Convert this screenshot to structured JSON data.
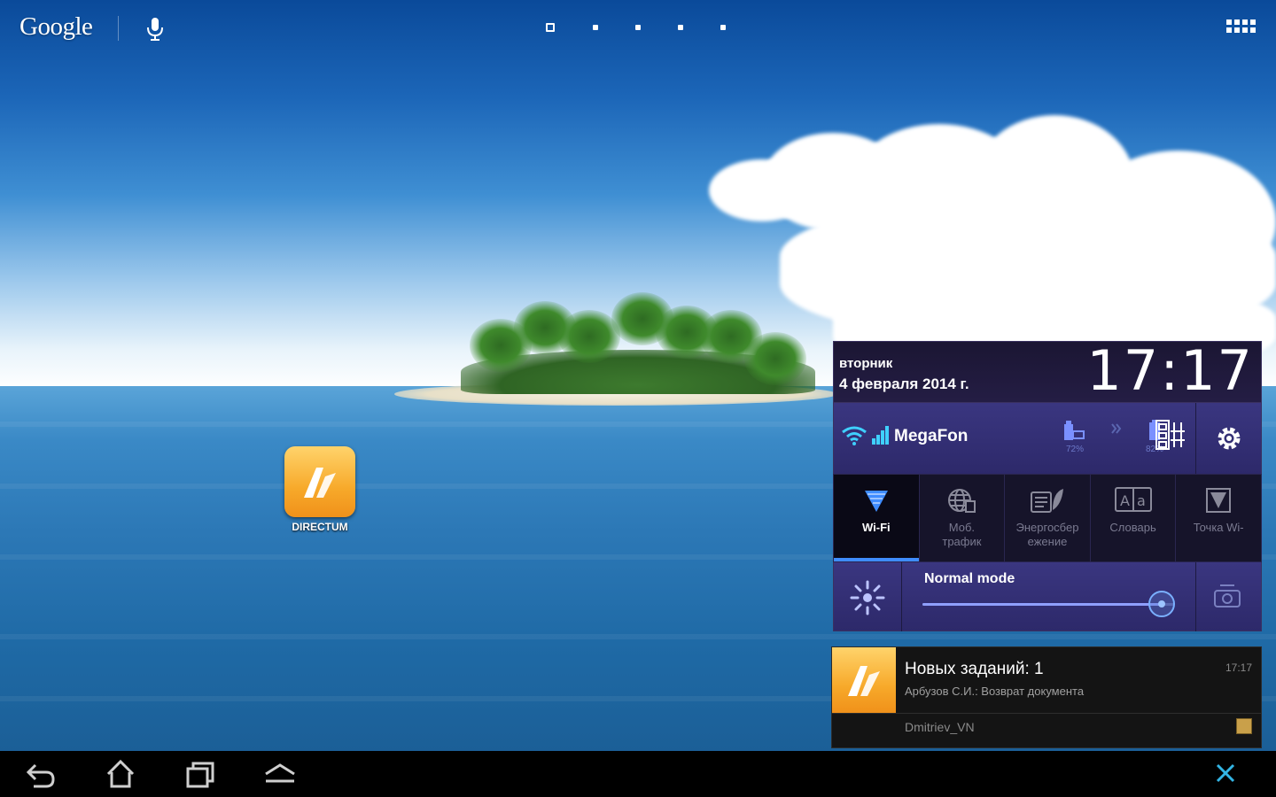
{
  "search": {
    "logo": "Google",
    "voice_icon": "mic-icon"
  },
  "workspace": {
    "pages": 5,
    "current_page": 1
  },
  "apps_button_icon": "apps-grid-icon",
  "desktop": {
    "shortcut": {
      "label": "DIRECTUM",
      "icon": "directum-icon"
    }
  },
  "panel": {
    "day": "вторник",
    "date": "4 февраля 2014 г.",
    "time": "17:17",
    "carrier": "MegaFon",
    "battery_1": "72%",
    "battery_2": "82%",
    "toggles": [
      {
        "label": "Wi-Fi",
        "icon": "wifi-icon",
        "active": true
      },
      {
        "label": "Моб.\nтрафик",
        "icon": "globe-icon",
        "active": false
      },
      {
        "label": "Энергосбер\nежение",
        "icon": "power-saver-icon",
        "active": false
      },
      {
        "label": "Словарь",
        "icon": "dictionary-icon",
        "active": false
      },
      {
        "label": "Точка Wi-",
        "icon": "hotspot-icon",
        "active": false
      }
    ],
    "brightness": {
      "mode": "Normal mode",
      "level": 0.95
    }
  },
  "notification": {
    "title": "Новых заданий: 1",
    "text": "Арбузов С.И.: Возврат документа",
    "user": "Dmitriev_VN",
    "time": "17:17"
  },
  "colors": {
    "accent": "#3f8cff",
    "panel": "#2d296a",
    "directum": "#f7a92a"
  }
}
